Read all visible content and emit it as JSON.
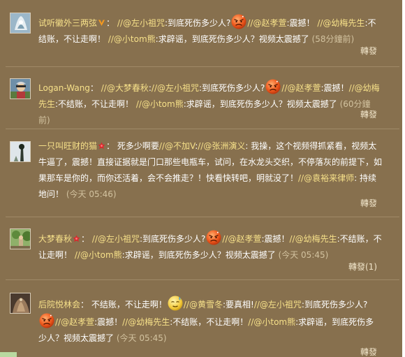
{
  "comments": [
    {
      "user": "试听徽外三两弦",
      "sep": "：",
      "line1a": "//@左小祖咒",
      "line1b": ":到底死伤多少人?",
      "line1c": "//@赵孝萱",
      "line1d": ":震撼！",
      "line1e": "//@幼梅先生",
      "line1f": ":不结账，不让走啊！",
      "line1g": "//@小tom熊",
      "line1h": ":求辟谣，到底死伤多少人？视频太震撼了",
      "time": "(58分鐘前)",
      "repost": "轉發"
    },
    {
      "user": "Logan-Wang",
      "sep": "：",
      "a": "//@大梦春秋",
      "b": ":",
      "c": "//@左小祖咒",
      "d": ":到底死伤多少人?",
      "e": "//@赵孝萱",
      "f": ":震撼！",
      "g": "//@幼梅先生",
      "h": ":不结账，不让走啊！",
      "i": "//@小tom熊",
      "j": ":求辟谣，到底死伤多少人？视频太震撼了",
      "time": "(60分鐘前)",
      "repost": "轉發"
    },
    {
      "user": "一只叫旺财的猫",
      "sep": "：",
      "a": "死多少啊要",
      "b": "//@不加V",
      "c": ":",
      "d": "//@张洲演义",
      "e": ": 我操，这个视频得抓紧看，视频太牛逼了，震撼！直接证据就是门口那些电瓶车，试问，在水龙头交织，不停落灰的前提下，如果那车是你的，而你还活着，会不会推走？！快看快转吧，明就没了！",
      "f": "//@袁裕来律师",
      "g": ": 持续地问！",
      "time": "(今天 05:46)",
      "repost": "轉發"
    },
    {
      "user": "大梦春秋",
      "sep": "：",
      "a": "//@左小祖咒",
      "b": ":到底死伤多少人?",
      "c": "//@赵孝萱",
      "d": ":震撼！",
      "e": "//@幼梅先生",
      "f": ":不结账，不让走啊！",
      "g": "//@小tom熊",
      "h": ":求辟谣，到底死伤多少人？视频太震撼了",
      "time": "(今天 05:45)",
      "repost": "轉發(1)"
    },
    {
      "user": "后院悦林会",
      "sep": "：",
      "a": "不结账，不让走啊！",
      "b": "//@黄雪冬",
      "c": ":要真相!",
      "d": "//@左小祖咒",
      "e": ":到底死伤多少人?",
      "f": "//@赵孝萱",
      "g": ":震撼！",
      "h": "//@幼梅先生",
      "i": ":不结账，不让走啊！",
      "j": "//@小tom熊",
      "k": ":求辟谣，到底死伤多少人？视频太震撼了",
      "time": "(今天 05:45)",
      "repost": "轉發"
    }
  ],
  "colors": {
    "background": "#87704e",
    "username": "#f6e089",
    "text": "#ffffff",
    "time": "#d2c29f"
  },
  "icons": {
    "vip": "v-badge-icon",
    "flower": "red-flower-badge-icon",
    "angry": "angry-face-emoji",
    "sweat": "sweat-face-emoji"
  }
}
